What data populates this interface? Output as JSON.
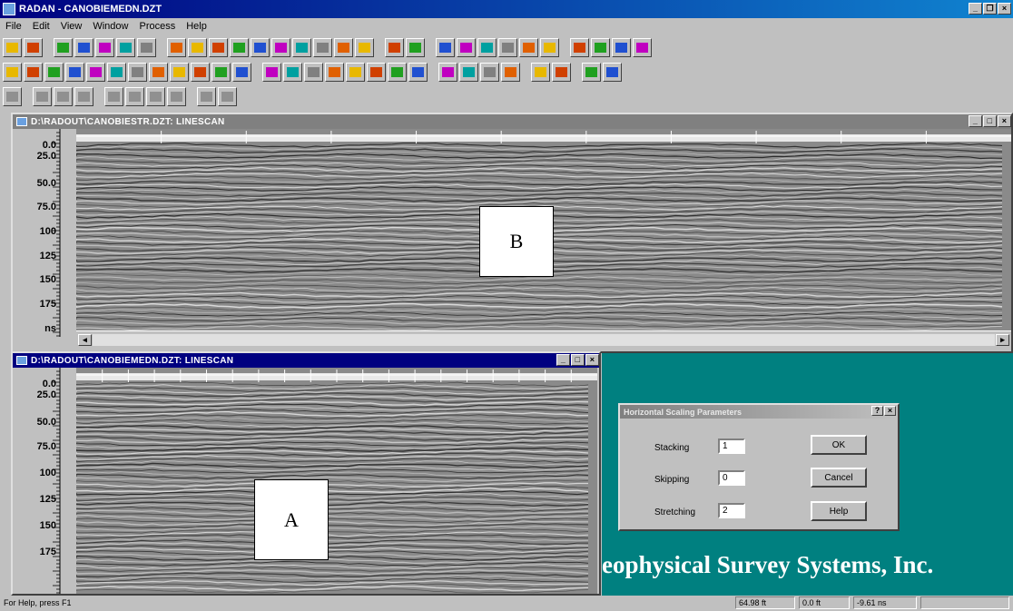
{
  "app": {
    "title": "RADAN - CANOBIEMEDN.DZT"
  },
  "menu": [
    "File",
    "Edit",
    "View",
    "Window",
    "Process",
    "Help"
  ],
  "colors": {
    "titlebar": "#000080",
    "inactive_title": "#808080",
    "mdi_background": "#008080"
  },
  "toolbar_icons": {
    "row1": [
      "open-icon",
      "save-icon",
      "new-icon",
      "cut-icon",
      "copy-icon",
      "paste-icon",
      "print-icon",
      "edit-icon",
      "view-icon",
      "wiggle-icon",
      "line-icon",
      "wave-icon",
      "grid-icon",
      "zoom-icon",
      "chart-icon",
      "display-icon",
      "printer-icon",
      "help-icon",
      "help-context-icon",
      "left-arrow-icon",
      "right-arrow-icon",
      "play-icon",
      "pause-icon",
      "stop-icon",
      "record-icon",
      "tool1-icon",
      "tool2-icon",
      "tool3-icon",
      "tool4-icon"
    ],
    "row2": [
      "filter1-icon",
      "filter2-icon",
      "filter3-icon",
      "filter4-icon",
      "filter5-icon",
      "filter6-icon",
      "filter7-icon",
      "filter8-icon",
      "filter9-icon",
      "filter10-icon",
      "filter11-icon",
      "filter12-icon",
      "process1-icon",
      "process2-icon",
      "process3-icon",
      "process4-icon",
      "process5-icon",
      "process6-icon",
      "process7-icon",
      "process8-icon",
      "process9-icon",
      "process10-icon",
      "process11-icon",
      "process12-icon",
      "process13-icon",
      "process14-icon",
      "process15-icon",
      "process16-icon"
    ],
    "row3": [
      "mark1-icon",
      "mark2-icon",
      "mark3-icon",
      "mark4-icon",
      "mark5-icon",
      "mark6-icon",
      "mark7-icon",
      "mark8-icon",
      "mark9-icon",
      "mark10-icon"
    ]
  },
  "window_b": {
    "title": "D:\\RADOUT\\CANOBIESTR.DZT:  LINESCAN",
    "y_labels": [
      "0.0",
      "25.0",
      "50.0",
      "75.0",
      "100",
      "125",
      "150",
      "175",
      "ns"
    ],
    "annotation": "B"
  },
  "window_a": {
    "title": "D:\\RADOUT\\CANOBIEMEDN.DZT:  LINESCAN",
    "y_labels": [
      "0.0",
      "25.0",
      "50.0",
      "75.0",
      "100",
      "125",
      "150",
      "175"
    ],
    "annotation": "A"
  },
  "dialog": {
    "title": "Horizontal Scaling Parameters",
    "fields": [
      {
        "label": "Stacking",
        "value": "1"
      },
      {
        "label": "Skipping",
        "value": "0"
      },
      {
        "label": "Stretching",
        "value": "2"
      }
    ],
    "buttons": [
      "OK",
      "Cancel",
      "Help"
    ]
  },
  "background_text": "eophysical Survey Systems, Inc.",
  "status": {
    "help": "For Help, press F1",
    "distance": "64.98 ft",
    "position": "0.0 ft",
    "time": "-9.61 ns"
  }
}
